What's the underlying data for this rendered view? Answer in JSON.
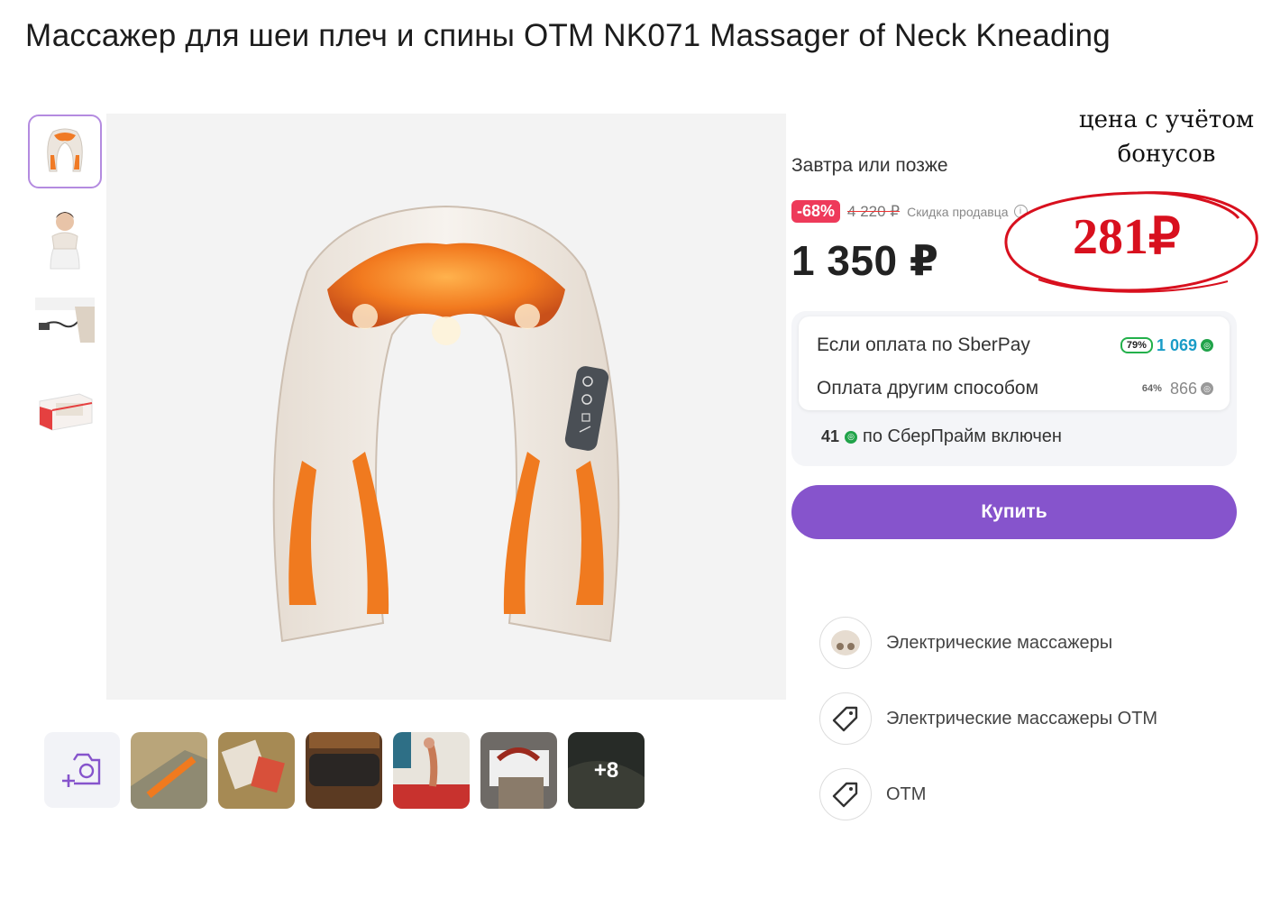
{
  "product": {
    "title": "Массажер для шеи плеч и спины OTM NK071 Massager of Neck Kneading"
  },
  "thumbnails": [
    "massager-front",
    "woman-with-massager",
    "charger-cable",
    "product-box"
  ],
  "gallery": {
    "more_label": "+8",
    "items": [
      "review-photo-1",
      "review-photo-2",
      "review-photo-3",
      "review-photo-4",
      "review-photo-5",
      "review-photo-6"
    ]
  },
  "buybox": {
    "delivery": "Завтра или позже",
    "discount_badge": "-68%",
    "old_price": "4 220 ₽",
    "seller_discount": "Скидка продавца",
    "price": "1 350 ₽",
    "annotation_text": "цена с учётом бонусов",
    "annotation_price": "281₽"
  },
  "payment": {
    "sberpay_label": "Если оплата по SberPay",
    "sberpay_pct": "79%",
    "sberpay_bonus": "1 069",
    "other_label": "Оплата другим способом",
    "other_pct": "64%",
    "other_bonus": "866",
    "prime_bonus": "41",
    "prime_label": "по СберПрайм включен"
  },
  "buy_button": "Купить",
  "categories": [
    {
      "label": "Электрические массажеры",
      "icon": "massager-category-icon"
    },
    {
      "label": "Электрические массажеры OTM",
      "icon": "tag-icon"
    },
    {
      "label": "OTM",
      "icon": "tag-icon"
    }
  ],
  "colors": {
    "accent": "#8654cc",
    "discount": "#ee3a5a",
    "annotation": "#d8101e",
    "bonus_green": "#21a34a"
  }
}
